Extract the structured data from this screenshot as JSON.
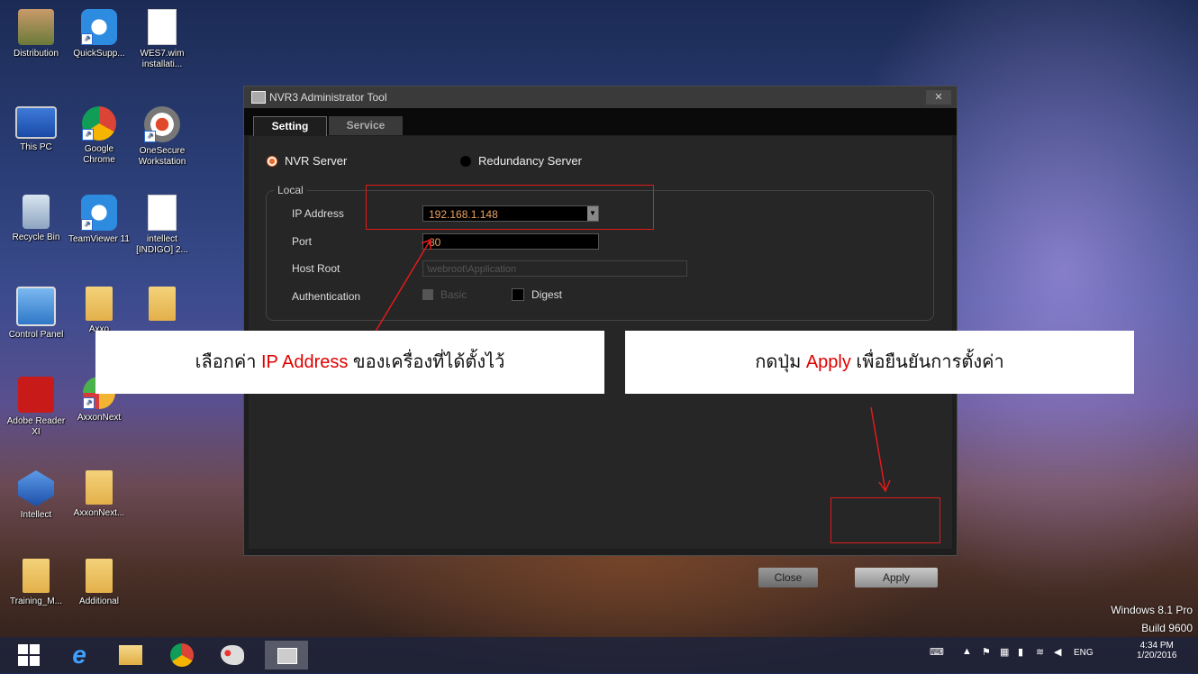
{
  "desktop_icons": [
    {
      "label": "Distribution",
      "icon": "user-icon"
    },
    {
      "label": "QuickSupp...",
      "icon": "teamviewer-icon"
    },
    {
      "label": "WES7.wim installati...",
      "icon": "document-icon"
    },
    {
      "label": "This PC",
      "icon": "computer-icon"
    },
    {
      "label": "Google Chrome",
      "icon": "chrome-icon"
    },
    {
      "label": "OneSecure Workstation",
      "icon": "eye-icon"
    },
    {
      "label": "Recycle Bin",
      "icon": "recycle-bin-icon"
    },
    {
      "label": "TeamViewer 11",
      "icon": "teamviewer-icon"
    },
    {
      "label": "intellect [INDIGO] 2...",
      "icon": "document-icon"
    },
    {
      "label": "Control Panel",
      "icon": "control-panel-icon"
    },
    {
      "label": "Axxo",
      "icon": "folder-icon"
    },
    {
      "label": "",
      "icon": "folder-icon"
    },
    {
      "label": "Adobe Reader XI",
      "icon": "adobe-icon"
    },
    {
      "label": "AxxonNext",
      "icon": "axxon-icon"
    },
    {
      "label": "Intellect",
      "icon": "intellect-icon"
    },
    {
      "label": "AxxonNext...",
      "icon": "folder-icon"
    },
    {
      "label": "Training_M...",
      "icon": "folder-icon"
    },
    {
      "label": "Additional",
      "icon": "folder-icon"
    }
  ],
  "window": {
    "title": "NVR3 Administrator Tool",
    "close": "✕",
    "tabs": [
      "Setting",
      "Service"
    ],
    "server_options": {
      "nvr": "NVR Server",
      "redundancy": "Redundancy Server"
    },
    "group_label": "Local",
    "fields": {
      "ip_label": "IP Address",
      "ip_value": "192.168.1.148",
      "port_label": "Port",
      "port_value": "80",
      "host_label": "Host Root",
      "host_value": "\\webroot\\Application",
      "auth_label": "Authentication",
      "basic": "Basic",
      "digest": "Digest"
    },
    "buttons": {
      "close": "Close",
      "apply": "Apply"
    }
  },
  "callouts": {
    "left_prefix": "เลือกค่า ",
    "left_highlight": "IP Address",
    "left_suffix": " ของเครื่องที่ได้ตั้งไว้",
    "right_prefix": "กดปุ่ม ",
    "right_highlight": "Apply",
    "right_suffix": " เพื่อยืนยันการตั้งค่า"
  },
  "taskbar": {
    "apps": [
      "windows-start-icon",
      "ie-icon",
      "file-explorer-icon",
      "chrome-icon",
      "paint-icon",
      "nvr-tool-icon"
    ],
    "lang": "ENG",
    "time": "4:34 PM",
    "date": "1/20/2016"
  },
  "watermark": {
    "line1": "Windows 8.1 Pro",
    "line2": "Build 9600"
  },
  "colors": {
    "highlight_red": "#e00000",
    "accent_orange": "#e96d2e"
  }
}
